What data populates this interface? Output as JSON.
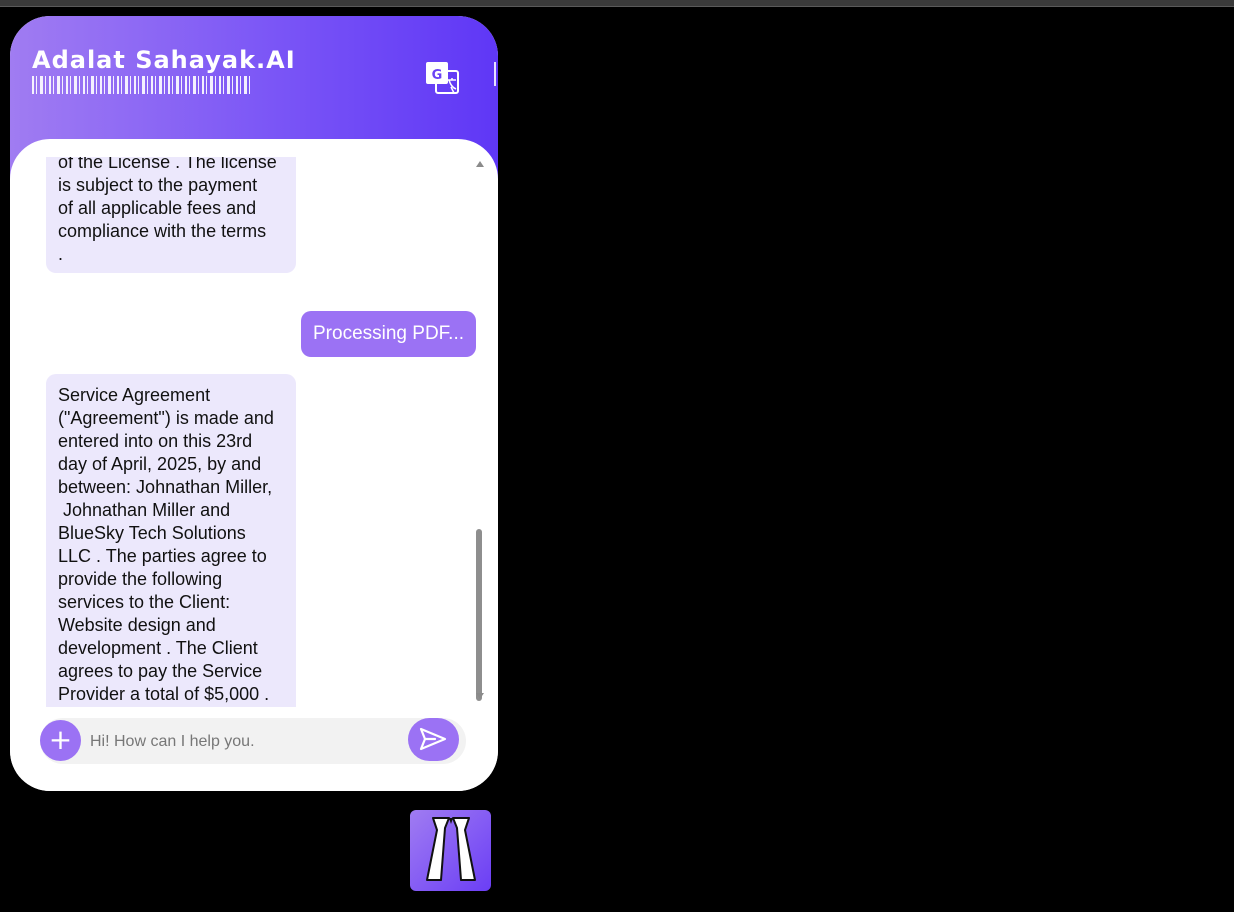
{
  "header": {
    "title": "Adalat Sahayak.AI",
    "translate_icon": "google-translate-icon"
  },
  "messages": [
    {
      "role": "bot",
      "lines": [
        "of the License . The license",
        "is subject to the payment",
        "of all applicable fees and",
        "compliance with the terms",
        "."
      ]
    },
    {
      "role": "user",
      "text": "Processing PDF..."
    },
    {
      "role": "bot",
      "lines": [
        "Service Agreement",
        "(\"Agreement\") is made and",
        "entered into on this 23rd",
        "day of April, 2025, by and",
        "between: Johnathan Miller,",
        " Johnathan Miller and",
        "BlueSky Tech Solutions",
        "LLC . The parties agree to",
        "provide the following",
        "services to the Client:",
        "Website design and",
        "development . The Client",
        "agrees to pay the Service",
        "Provider a total of $5,000 ."
      ]
    }
  ],
  "input": {
    "placeholder": "Hi! How can I help you.",
    "value": "",
    "plus_label": "+",
    "send_icon": "send-icon"
  },
  "launcher": {
    "icon": "lawyer-bands-icon"
  },
  "colors": {
    "accent": "#9b72f4",
    "header_start": "#a07cf2",
    "header_end": "#5f37f6",
    "bot_bubble": "#ece8fc"
  }
}
